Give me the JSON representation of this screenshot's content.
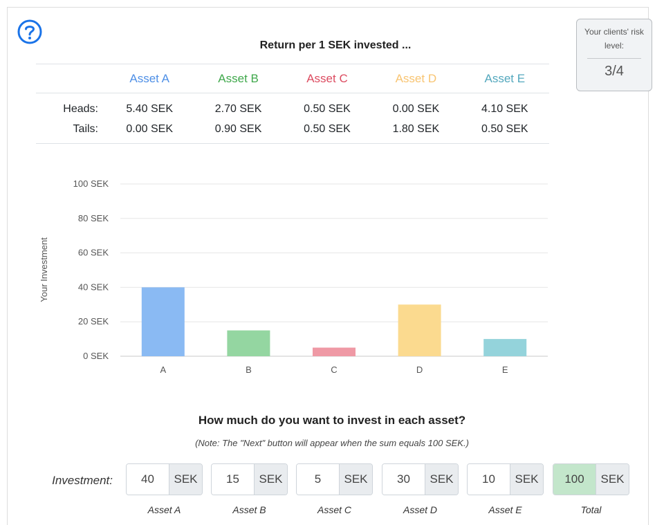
{
  "colors": {
    "asset_a": "#4e8fe6",
    "asset_b": "#3fa84b",
    "asset_c": "#dc4b60",
    "asset_d": "#f8c471",
    "asset_e": "#52a7bd",
    "bar_a": "#8abaf3",
    "bar_b": "#94d6a1",
    "bar_c": "#ef99a5",
    "bar_d": "#fbda8f",
    "bar_e": "#94d3db",
    "help_icon": "#1a73e8"
  },
  "header": {
    "title": "Return per 1 SEK invested ...",
    "help_icon": "question-circle-icon"
  },
  "risk": {
    "label": "Your clients' risk level:",
    "value": "3/4"
  },
  "returns_table": {
    "assets": [
      "Asset A",
      "Asset B",
      "Asset C",
      "Asset D",
      "Asset E"
    ],
    "rows": [
      {
        "label": "Heads:",
        "values": [
          "5.40 SEK",
          "2.70 SEK",
          "0.50 SEK",
          "0.00 SEK",
          "4.10 SEK"
        ]
      },
      {
        "label": "Tails:",
        "values": [
          "0.00 SEK",
          "0.90 SEK",
          "0.50 SEK",
          "1.80 SEK",
          "0.50 SEK"
        ]
      }
    ]
  },
  "chart_data": {
    "type": "bar",
    "categories": [
      "A",
      "B",
      "C",
      "D",
      "E"
    ],
    "values": [
      40,
      15,
      5,
      30,
      10
    ],
    "ylabel": "Your Investment",
    "xlabel": "",
    "ylim": [
      0,
      100
    ],
    "yticks": [
      "0 SEK",
      "20 SEK",
      "40 SEK",
      "60 SEK",
      "80 SEK",
      "100 SEK"
    ],
    "grid": true
  },
  "question": {
    "title": "How much do you want to invest in each asset?",
    "note": "(Note: The \"Next\" button will appear when the sum equals 100 SEK.)",
    "row_label": "Investment:"
  },
  "investments": [
    {
      "value": "40",
      "unit": "SEK",
      "caption": "Asset A"
    },
    {
      "value": "15",
      "unit": "SEK",
      "caption": "Asset B"
    },
    {
      "value": "5",
      "unit": "SEK",
      "caption": "Asset C"
    },
    {
      "value": "30",
      "unit": "SEK",
      "caption": "Asset D"
    },
    {
      "value": "10",
      "unit": "SEK",
      "caption": "Asset E"
    }
  ],
  "total": {
    "value": "100",
    "unit": "SEK",
    "caption": "Total"
  }
}
